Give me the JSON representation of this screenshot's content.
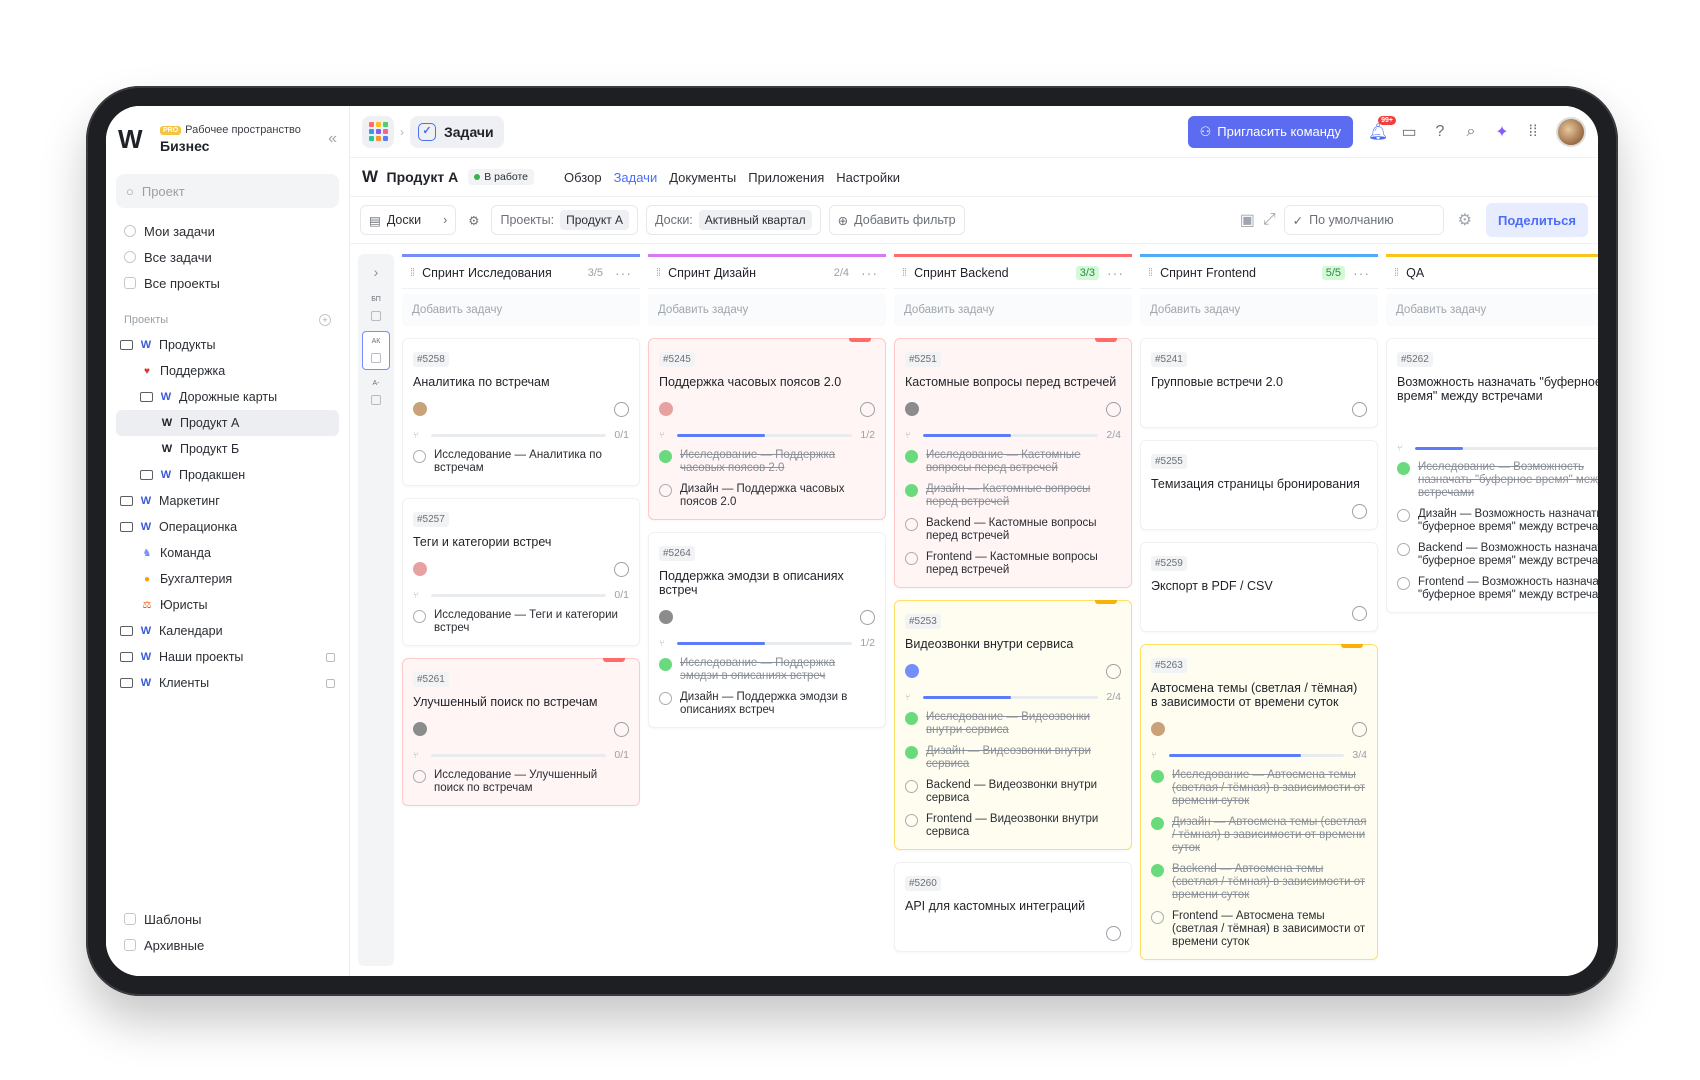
{
  "workspace": {
    "badge": "PRO",
    "subtitle": "Рабочее пространство",
    "name": "Бизнес"
  },
  "sidebar": {
    "search_placeholder": "Проект",
    "nav": [
      {
        "label": "Мои задачи",
        "icon": "check-circle-icon"
      },
      {
        "label": "Все задачи",
        "icon": "check-circle-icon"
      },
      {
        "label": "Все проекты",
        "icon": "folder-icon"
      }
    ],
    "projects_title": "Проекты",
    "tree": [
      {
        "label": "Продукты",
        "indent": 0,
        "icon": "folder"
      },
      {
        "label": "Поддержка",
        "indent": 1,
        "icon": "heart"
      },
      {
        "label": "Дорожные карты",
        "indent": 1,
        "icon": "folder"
      },
      {
        "label": "Продукт А",
        "indent": 2,
        "icon": "w",
        "active": true
      },
      {
        "label": "Продукт Б",
        "indent": 2,
        "icon": "w"
      },
      {
        "label": "Продакшен",
        "indent": 1,
        "icon": "folder"
      },
      {
        "label": "Маркетинг",
        "indent": 0,
        "icon": "folder"
      },
      {
        "label": "Операционка",
        "indent": 0,
        "icon": "folder"
      },
      {
        "label": "Команда",
        "indent": 1,
        "icon": "team"
      },
      {
        "label": "Бухгалтерия",
        "indent": 1,
        "icon": "coin"
      },
      {
        "label": "Юристы",
        "indent": 1,
        "icon": "law"
      },
      {
        "label": "Календари",
        "indent": 0,
        "icon": "folder"
      },
      {
        "label": "Наши проекты",
        "indent": 0,
        "icon": "folder",
        "locked": true
      },
      {
        "label": "Клиенты",
        "indent": 0,
        "icon": "folder",
        "locked": true
      }
    ],
    "bottom": [
      {
        "label": "Шаблоны"
      },
      {
        "label": "Архивные"
      }
    ]
  },
  "topbar": {
    "section": "Задачи",
    "invite": "Пригласить команду",
    "notif_count": "99+"
  },
  "project": {
    "name": "Продукт А",
    "status": "В работе",
    "tabs": [
      "Обзор",
      "Задачи",
      "Документы",
      "Приложения",
      "Настройки"
    ],
    "active_tab": 1
  },
  "filters": {
    "view": "Доски",
    "projects_label": "Проекты:",
    "projects_value": "Продукт А",
    "boards_label": "Доски:",
    "boards_value": "Активный квартал",
    "add_filter": "Добавить фильтр",
    "sort": "По умолчанию",
    "share": "Поделиться"
  },
  "rail": {
    "labels": [
      "БП",
      "АК",
      "А-"
    ]
  },
  "columns": [
    {
      "title": "Спринт Исследования",
      "count": "3/5",
      "done": false,
      "color": "#748ffc",
      "add": "Добавить задачу",
      "cards": [
        {
          "id": "#5258",
          "title": "Аналитика по встречам",
          "tone": "",
          "progress": 0,
          "progress_label": "0/1",
          "subs": [
            {
              "text": "Исследование — Аналитика по встречам",
              "done": false
            }
          ]
        },
        {
          "id": "#5257",
          "title": "Теги и категории встреч",
          "tone": "",
          "progress": 0,
          "progress_label": "0/1",
          "subs": [
            {
              "text": "Исследование — Теги и категории встреч",
              "done": false
            }
          ]
        },
        {
          "id": "#5261",
          "title": "Улучшенный поиск по встречам",
          "tone": "red",
          "progress": 0,
          "progress_label": "0/1",
          "subs": [
            {
              "text": "Исследование — Улучшенный поиск по встречам",
              "done": false
            }
          ]
        }
      ]
    },
    {
      "title": "Спринт Дизайн",
      "count": "2/4",
      "done": false,
      "color": "#da77f2",
      "add": "Добавить задачу",
      "cards": [
        {
          "id": "#5245",
          "title": "Поддержка часовых поясов 2.0",
          "tone": "red",
          "progress": 0.5,
          "progress_label": "1/2",
          "subs": [
            {
              "text": "Исследование — Поддержка часовых поясов 2.0",
              "done": true
            },
            {
              "text": "Дизайн — Поддержка часовых поясов 2.0",
              "done": false
            }
          ]
        },
        {
          "id": "#5264",
          "title": "Поддержка эмодзи в описаниях встреч",
          "tone": "",
          "progress": 0.5,
          "progress_label": "1/2",
          "subs": [
            {
              "text": "Исследование — Поддержка эмодзи в описаниях встреч",
              "done": true
            },
            {
              "text": "Дизайн — Поддержка эмодзи в описаниях встреч",
              "done": false
            }
          ]
        }
      ]
    },
    {
      "title": "Спринт Backend",
      "count": "3/3",
      "done": true,
      "color": "#ff6b6b",
      "add": "Добавить задачу",
      "cards": [
        {
          "id": "#5251",
          "title": "Кастомные вопросы перед встречей",
          "tone": "red",
          "progress": 0.5,
          "progress_label": "2/4",
          "subs": [
            {
              "text": "Исследование — Кастомные вопросы перед встречей",
              "done": true
            },
            {
              "text": "Дизайн — Кастомные вопросы перед встречей",
              "done": true
            },
            {
              "text": "Backend — Кастомные вопросы перед встречей",
              "done": false
            },
            {
              "text": "Frontend — Кастомные вопросы перед встречей",
              "done": false
            }
          ]
        },
        {
          "id": "#5253",
          "title": "Видеозвонки внутри сервиса",
          "tone": "yellow",
          "progress": 0.5,
          "progress_label": "2/4",
          "subs": [
            {
              "text": "Исследование — Видеозвонки внутри сервиса",
              "done": true
            },
            {
              "text": "Дизайн — Видеозвонки внутри сервиса",
              "done": true
            },
            {
              "text": "Backend — Видеозвонки внутри сервиса",
              "done": false
            },
            {
              "text": "Frontend — Видеозвонки внутри сервиса",
              "done": false
            }
          ]
        },
        {
          "id": "#5260",
          "title": "API для кастомных интеграций",
          "tone": "",
          "progress": null,
          "progress_label": "",
          "subs": []
        }
      ]
    },
    {
      "title": "Спринт Frontend",
      "count": "5/5",
      "done": true,
      "color": "#4dabf7",
      "add": "Добавить задачу",
      "cards": [
        {
          "id": "#5241",
          "title": "Групповые встречи 2.0",
          "tone": "",
          "progress": null,
          "progress_label": "",
          "subs": []
        },
        {
          "id": "#5255",
          "title": "Темизация страницы бронирования",
          "tone": "",
          "progress": null,
          "progress_label": "",
          "subs": []
        },
        {
          "id": "#5259",
          "title": "Экспорт в PDF / CSV",
          "tone": "",
          "progress": null,
          "progress_label": "",
          "subs": []
        },
        {
          "id": "#5263",
          "title": "Автосмена темы (светлая / тёмная) в зависимости от времени суток",
          "tone": "yellow",
          "progress": 0.75,
          "progress_label": "3/4",
          "subs": [
            {
              "text": "Исследование — Автосмена темы (светлая / тёмная) в зависимости от времени суток",
              "done": true
            },
            {
              "text": "Дизайн — Автосмена темы (светлая / тёмная) в зависимости от времени суток",
              "done": true
            },
            {
              "text": "Backend — Автосмена темы (светлая / тёмная) в зависимости от времени суток",
              "done": true
            },
            {
              "text": "Frontend — Автосмена темы (светлая / тёмная) в зависимости от времени суток",
              "done": false
            }
          ]
        }
      ]
    },
    {
      "title": "QA",
      "count": "",
      "done": false,
      "color": "#fcc419",
      "add": "Добавить задачу",
      "cards": [
        {
          "id": "#5262",
          "title": "Возможность назначать \"буферное время\" между встречами",
          "tone": "",
          "progress": 0.25,
          "progress_label": "",
          "subs": [
            {
              "text": "Исследование — Возможность назначать \"буферное время\" между встречами",
              "done": true
            },
            {
              "text": "Дизайн — Возможность назначать \"буферное время\" между встречами",
              "done": false
            },
            {
              "text": "Backend — Возможность назначать \"буферное время\" между встречами",
              "done": false
            },
            {
              "text": "Frontend — Возможность назначать \"буферное время\" между встречами",
              "done": false
            }
          ]
        }
      ]
    }
  ]
}
